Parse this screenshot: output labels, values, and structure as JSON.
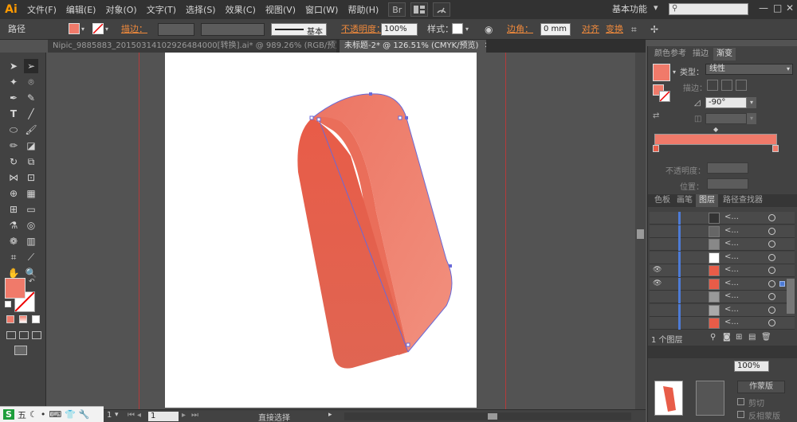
{
  "app": {
    "logo": "Ai"
  },
  "menu": [
    "文件(F)",
    "编辑(E)",
    "对象(O)",
    "文字(T)",
    "选择(S)",
    "效果(C)",
    "视图(V)",
    "窗口(W)",
    "帮助(H)"
  ],
  "menubar_buttons": {
    "br": "Br",
    "st": "St"
  },
  "workspace": {
    "label": "基本功能",
    "arrow": "▾"
  },
  "window_controls": {
    "minimize": "—",
    "restore": "□",
    "close": "✕"
  },
  "control_bar": {
    "selection_label": "路径",
    "stroke_label": "描边：",
    "stroke_style": "基本",
    "opacity_label": "不透明度：",
    "opacity_value": "100%",
    "style_label": "样式：",
    "corner_label": "边角：",
    "corner_value": "0 mm",
    "align_label": "对齐",
    "transform_label": "变换",
    "fill_color": "#f07a6a"
  },
  "tabs": [
    {
      "label": "Nipic_9885883_20150314102926484000[转换].ai* @ 989.26% (RGB/预览)",
      "close": "✕",
      "active": false
    },
    {
      "label": "未标题-2* @ 126.51% (CMYK/预览)",
      "close": "✕",
      "active": true
    }
  ],
  "panels": {
    "gradient_tabs": [
      "颜色参考",
      "描边",
      "渐变"
    ],
    "gradient": {
      "type_label": "类型：",
      "type_value": "线性",
      "stroke_label": "描边：",
      "angle_value": "-90°",
      "opacity_label": "不透明度：",
      "location_label": "位置：",
      "stop_left_color": "#e85c48",
      "stop_right_color": "#f07a6a"
    },
    "layer_tabs": [
      "色板",
      "画笔",
      "图层",
      "路径查找器"
    ],
    "layer_rows": [
      {
        "name": "<...",
        "visible": false,
        "thumb": "#333333",
        "selected": false
      },
      {
        "name": "<...",
        "visible": false,
        "thumb": "#666666",
        "selected": false
      },
      {
        "name": "<...",
        "visible": false,
        "thumb": "#888888",
        "selected": false
      },
      {
        "name": "<...",
        "visible": false,
        "thumb": "#ffffff",
        "selected": false
      },
      {
        "name": "<...",
        "visible": true,
        "thumb": "#e85c48",
        "selected": false
      },
      {
        "name": "<...",
        "visible": true,
        "thumb": "#e85c48",
        "selected": true
      },
      {
        "name": "<...",
        "visible": false,
        "thumb": "#999999",
        "selected": false
      },
      {
        "name": "<...",
        "visible": false,
        "thumb": "#aaaaaa",
        "selected": false
      },
      {
        "name": "<...",
        "visible": false,
        "thumb": "#e85c48",
        "selected": false
      }
    ],
    "layer_count": "1 个图层",
    "bottom_labels": {
      "make_mask": "作蒙版",
      "clip": "剪切",
      "invert_mask": "反相蒙版",
      "opacity_value": "100%"
    }
  },
  "status": {
    "zoom": "1",
    "page": "1",
    "tool": "直接选择"
  },
  "taskbar": [
    "S",
    "五",
    "☾",
    "•",
    "⌨",
    "👕",
    "🔧"
  ],
  "artwork": {
    "colors": {
      "dark": "#e35f4a",
      "mid": "#ea6e5a",
      "light": "#f08a78",
      "anchor": "#6a6ad8"
    }
  }
}
